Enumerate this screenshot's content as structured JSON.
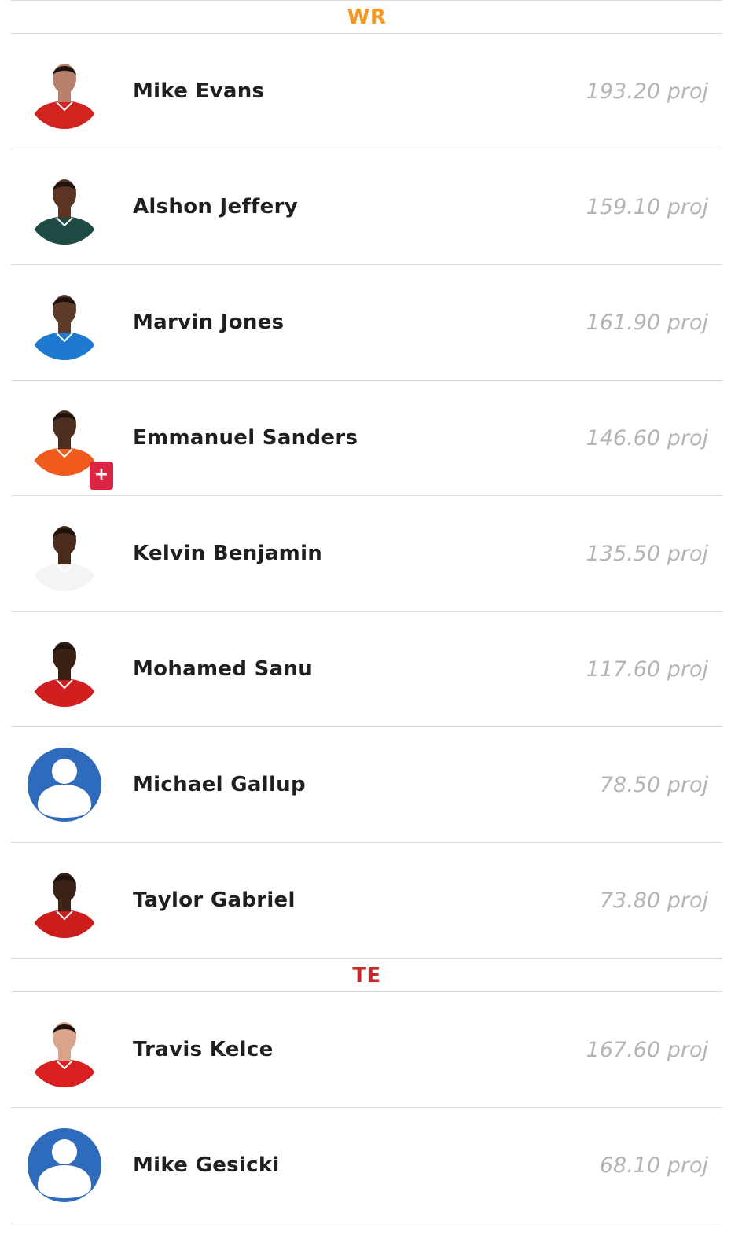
{
  "sections": [
    {
      "label": "WR",
      "color": "#f39a1e",
      "players": [
        {
          "name": "Mike Evans",
          "proj": "193.20 proj",
          "jersey": "#d1241e",
          "skin": "#b7806a",
          "photo": true
        },
        {
          "name": "Alshon Jeffery",
          "proj": "159.10 proj",
          "jersey": "#1e4a44",
          "skin": "#5b3424",
          "photo": true
        },
        {
          "name": "Marvin Jones",
          "proj": "161.90 proj",
          "jersey": "#1e7ad1",
          "skin": "#5e3a29",
          "photo": true
        },
        {
          "name": "Emmanuel Sanders",
          "proj": "146.60 proj",
          "jersey": "#f05a1c",
          "skin": "#4d2e1f",
          "photo": true,
          "badge": "+"
        },
        {
          "name": "Kelvin Benjamin",
          "proj": "135.50 proj",
          "jersey": "#f4f4f4",
          "skin": "#4a2b1c",
          "photo": true
        },
        {
          "name": "Mohamed Sanu",
          "proj": "117.60 proj",
          "jersey": "#d11f1f",
          "skin": "#3a2114",
          "photo": true
        },
        {
          "name": "Michael Gallup",
          "proj": "78.50 proj",
          "photo": false
        },
        {
          "name": "Taylor Gabriel",
          "proj": "73.80 proj",
          "jersey": "#cc1d1d",
          "skin": "#3c2216",
          "photo": true
        }
      ]
    },
    {
      "label": "TE",
      "color": "#c8282a",
      "players": [
        {
          "name": "Travis Kelce",
          "proj": "167.60 proj",
          "jersey": "#d91f1f",
          "skin": "#d9a38c",
          "photo": true
        },
        {
          "name": "Mike Gesicki",
          "proj": "68.10 proj",
          "photo": false
        }
      ]
    }
  ],
  "placeholder_color": "#2f6bbd"
}
